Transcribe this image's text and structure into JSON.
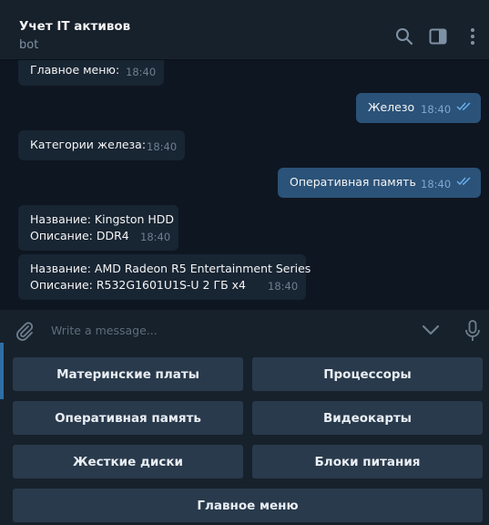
{
  "header": {
    "title": "Учет IT активов",
    "subtitle": "bot"
  },
  "messages": [
    {
      "direction": "in",
      "lines": [
        "Главное меню:"
      ],
      "time": "18:40"
    },
    {
      "direction": "out",
      "lines": [
        "Железо"
      ],
      "time": "18:40",
      "read": true
    },
    {
      "direction": "in",
      "lines": [
        "Категории железа:"
      ],
      "time": "18:40"
    },
    {
      "direction": "out",
      "lines": [
        "Оперативная память"
      ],
      "time": "18:40",
      "read": true
    },
    {
      "direction": "in",
      "lines": [
        "Название: Kingston HDD",
        "Описание: DDR4"
      ],
      "time": "18:40"
    },
    {
      "direction": "in",
      "lines": [
        "Название: AMD Radeon R5 Entertainment Series",
        "Описание: R532G1601U1S-U 2 ГБ x4"
      ],
      "time": "18:40"
    }
  ],
  "composer": {
    "placeholder": "Write a message..."
  },
  "keyboard": {
    "buttons": [
      "Материнские платы",
      "Процессоры",
      "Оперативная память",
      "Видеокарты",
      "Жесткие диски",
      "Блоки питания",
      "Главное меню"
    ]
  },
  "colors": {
    "background": "#0e1621",
    "panel": "#17212b",
    "incoming_bubble": "#182533",
    "outgoing_bubble": "#2b5278",
    "keyboard_button": "#293a4c",
    "read_check": "#6ab2f2"
  },
  "icons": [
    "search-icon",
    "sidebar-toggle-icon",
    "more-vertical-icon",
    "paperclip-icon",
    "chevron-down-icon",
    "microphone-icon",
    "double-check-icon"
  ]
}
